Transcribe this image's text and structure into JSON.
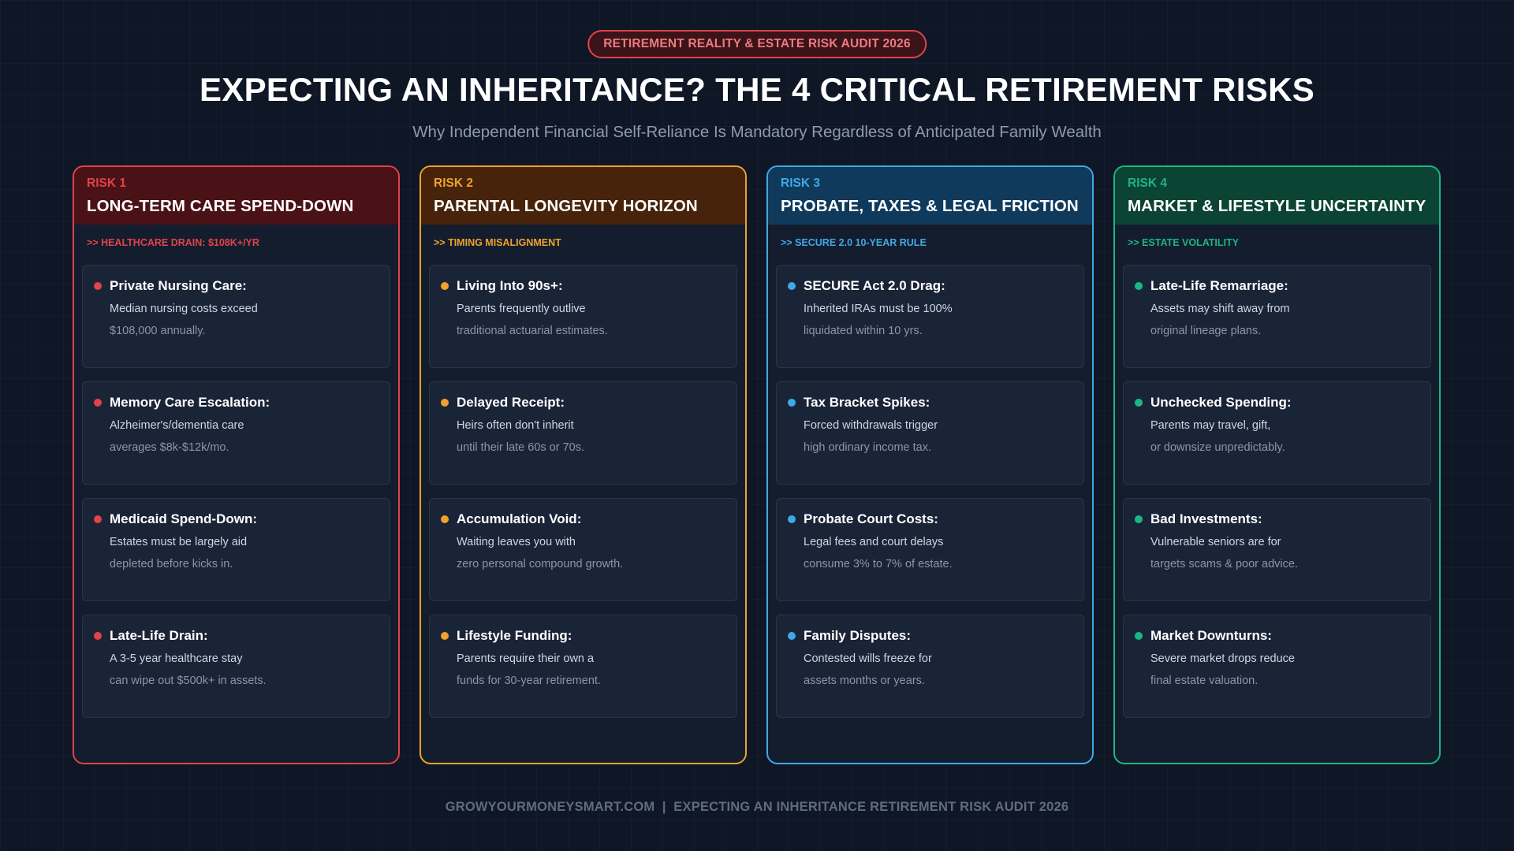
{
  "badge": "RETIREMENT REALITY & ESTATE RISK AUDIT 2026",
  "title": "EXPECTING AN INHERITANCE? THE 4 CRITICAL RETIREMENT RISKS",
  "subtitle": "Why Independent Financial Self-Reliance Is Mandatory Regardless of Anticipated Family Wealth",
  "colors": {
    "risk1": "#e0434a",
    "risk2": "#f0a22c",
    "risk3": "#3fa9e6",
    "risk4": "#1db584"
  },
  "risks": [
    {
      "number": "RISK 1",
      "title": "LONG-TERM CARE SPEND-DOWN",
      "tag": ">> HEALTHCARE DRAIN: $108K+/YR",
      "items": [
        {
          "title": "Private Nursing Care:",
          "line1": "Median nursing costs exceed",
          "line2": "$108,000 annually."
        },
        {
          "title": "Memory Care Escalation:",
          "line1": "Alzheimer's/dementia care",
          "line2": "averages $8k-$12k/mo."
        },
        {
          "title": "Medicaid Spend-Down:",
          "line1": "Estates must be largely aid",
          "line2": "depleted before kicks in."
        },
        {
          "title": "Late-Life Drain:",
          "line1": "A 3-5 year healthcare stay",
          "line2": "can wipe out $500k+ in assets."
        }
      ]
    },
    {
      "number": "RISK 2",
      "title": "PARENTAL LONGEVITY HORIZON",
      "tag": ">> TIMING MISALIGNMENT",
      "items": [
        {
          "title": "Living Into 90s+:",
          "line1": "Parents frequently outlive",
          "line2": "traditional actuarial estimates."
        },
        {
          "title": "Delayed Receipt:",
          "line1": "Heirs often don't inherit",
          "line2": "until their late 60s or 70s."
        },
        {
          "title": "Accumulation Void:",
          "line1": "Waiting leaves you with",
          "line2": "zero personal compound growth."
        },
        {
          "title": "Lifestyle Funding:",
          "line1": "Parents require their own a",
          "line2": "funds for 30-year retirement."
        }
      ]
    },
    {
      "number": "RISK 3",
      "title": "PROBATE, TAXES & LEGAL FRICTION",
      "tag": ">> SECURE 2.0 10-YEAR RULE",
      "items": [
        {
          "title": "SECURE Act 2.0 Drag:",
          "line1": "Inherited IRAs must be 100%",
          "line2": "liquidated within 10 yrs."
        },
        {
          "title": "Tax Bracket Spikes:",
          "line1": "Forced withdrawals trigger",
          "line2": "high ordinary income tax."
        },
        {
          "title": "Probate Court Costs:",
          "line1": "Legal fees and court delays",
          "line2": "consume 3% to 7% of estate."
        },
        {
          "title": "Family Disputes:",
          "line1": "Contested wills freeze for",
          "line2": "assets months or years."
        }
      ]
    },
    {
      "number": "RISK 4",
      "title": "MARKET & LIFESTYLE UNCERTAINTY",
      "tag": ">> ESTATE VOLATILITY",
      "items": [
        {
          "title": "Late-Life Remarriage:",
          "line1": "Assets may shift away from",
          "line2": "original lineage plans."
        },
        {
          "title": "Unchecked Spending:",
          "line1": "Parents may travel, gift,",
          "line2": "or downsize unpredictably."
        },
        {
          "title": "Bad Investments:",
          "line1": "Vulnerable seniors are for",
          "line2": "targets scams & poor advice."
        },
        {
          "title": "Market Downturns:",
          "line1": "Severe market drops reduce",
          "line2": "final estate valuation."
        }
      ]
    }
  ],
  "footer": "GROWYOURMONEYSMART.COM  |  EXPECTING AN INHERITANCE RETIREMENT RISK AUDIT 2026"
}
